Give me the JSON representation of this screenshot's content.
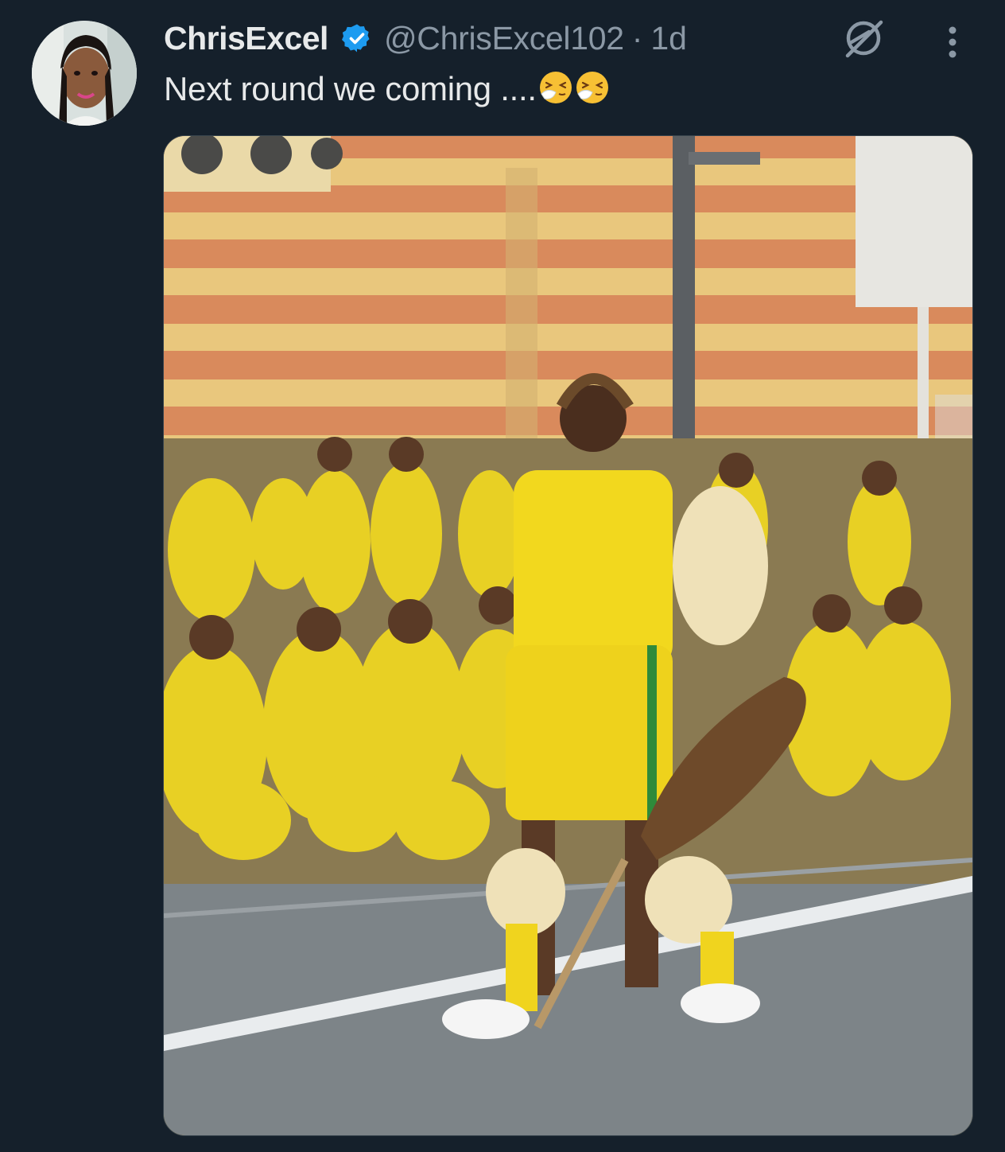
{
  "tweet": {
    "display_name": "ChrisExcel",
    "handle": "@ChrisExcel102",
    "separator": "·",
    "timestamp": "1d",
    "text": "Next round we coming ....",
    "emojis": [
      "sneezing-face-emoji",
      "sneezing-face-emoji"
    ]
  },
  "icons": {
    "verified": "verified-badge-icon",
    "grok": "grok-icon",
    "more": "more-options-icon"
  },
  "colors": {
    "background": "#15202b",
    "text": "#e7e9ea",
    "secondary_text": "#8b98a5",
    "verified": "#1d9bf0"
  }
}
